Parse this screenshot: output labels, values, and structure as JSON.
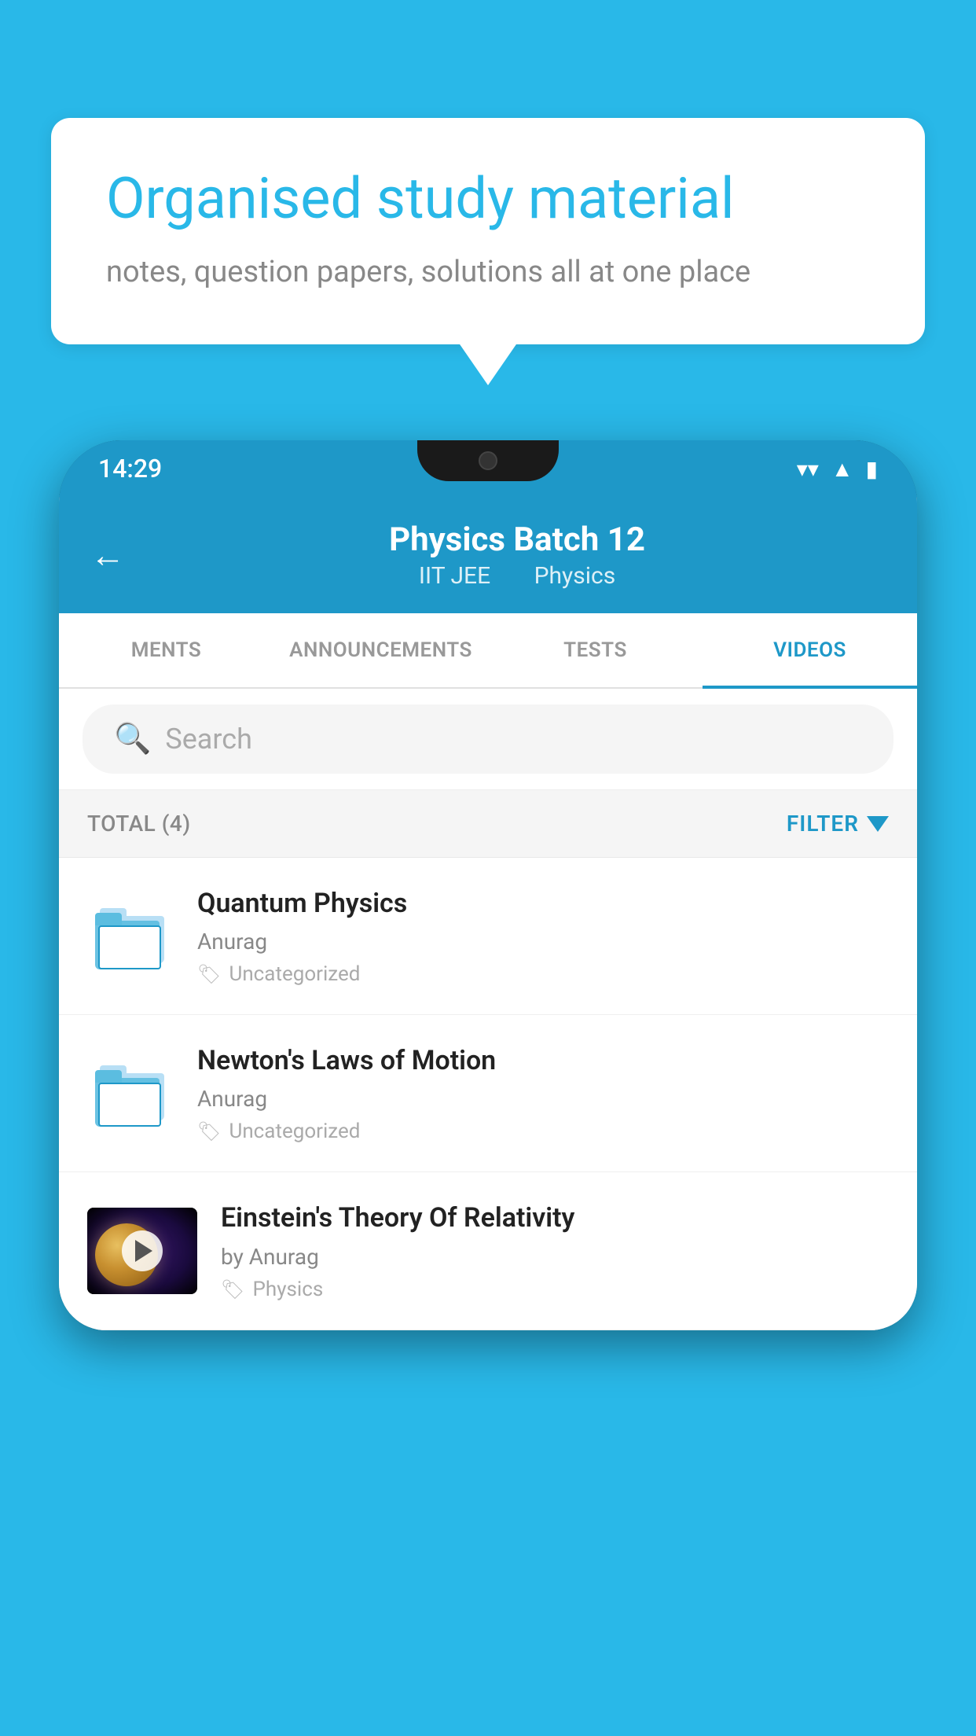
{
  "background_color": "#29b8e8",
  "speech_bubble": {
    "headline": "Organised study material",
    "subtext": "notes, question papers, solutions all at one place"
  },
  "phone": {
    "status_bar": {
      "time": "14:29"
    },
    "header": {
      "title": "Physics Batch 12",
      "subtitle_part1": "IIT JEE",
      "subtitle_part2": "Physics",
      "back_label": "←"
    },
    "tabs": [
      {
        "label": "MENTS",
        "active": false
      },
      {
        "label": "ANNOUNCEMENTS",
        "active": false
      },
      {
        "label": "TESTS",
        "active": false
      },
      {
        "label": "VIDEOS",
        "active": true
      }
    ],
    "search": {
      "placeholder": "Search"
    },
    "filter_bar": {
      "total_label": "TOTAL (4)",
      "filter_label": "FILTER"
    },
    "video_items": [
      {
        "id": 1,
        "title": "Quantum Physics",
        "author": "Anurag",
        "tag": "Uncategorized",
        "has_thumbnail": false
      },
      {
        "id": 2,
        "title": "Newton's Laws of Motion",
        "author": "Anurag",
        "tag": "Uncategorized",
        "has_thumbnail": false
      },
      {
        "id": 3,
        "title": "Einstein's Theory Of Relativity",
        "author": "by Anurag",
        "tag": "Physics",
        "has_thumbnail": true
      }
    ]
  }
}
